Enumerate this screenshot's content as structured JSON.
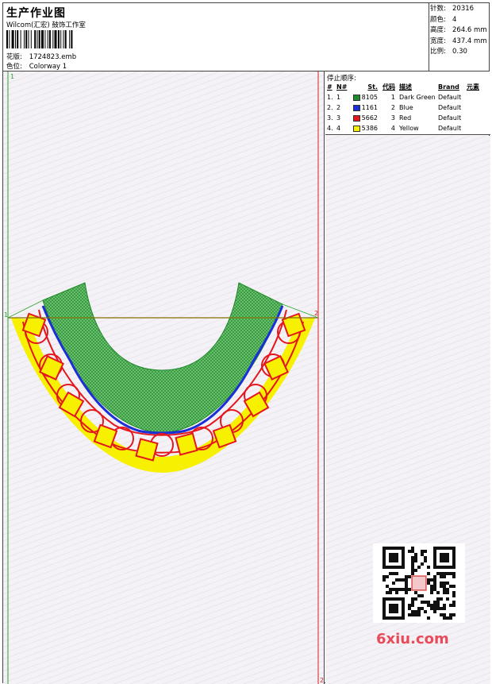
{
  "header": {
    "title": "生产作业图",
    "studio": "Wilcom(汇宏) 鼓饰工作室",
    "design_label": "花版:",
    "design_value": "1724823.emb",
    "colorway_label": "色位:",
    "colorway_value": "Colorway 1"
  },
  "stats": [
    {
      "label": "针数:",
      "value": "20316"
    },
    {
      "label": "颜色:",
      "value": "4"
    },
    {
      "label": "高度:",
      "value": "264.6 mm"
    },
    {
      "label": "宽度:",
      "value": "437.4 mm"
    },
    {
      "label": "比例:",
      "value": "0.30"
    }
  ],
  "stop_sequence": {
    "heading": "停止顺序:",
    "columns": [
      "#",
      "N#",
      "St.",
      "代码",
      "描述",
      "Brand",
      "元素"
    ],
    "rows": [
      {
        "idx": "1.",
        "n": "1",
        "color": "#1f8a2a",
        "st": "8105",
        "code": "1",
        "desc": "Dark Green",
        "brand": "Default"
      },
      {
        "idx": "2.",
        "n": "2",
        "color": "#1a2fd6",
        "st": "1161",
        "code": "2",
        "desc": "Blue",
        "brand": "Default"
      },
      {
        "idx": "3.",
        "n": "3",
        "color": "#e3171d",
        "st": "5662",
        "code": "3",
        "desc": "Red",
        "brand": "Default"
      },
      {
        "idx": "4.",
        "n": "4",
        "color": "#f7f000",
        "st": "5386",
        "code": "4",
        "desc": "Yellow",
        "brand": "Default"
      }
    ]
  },
  "canvas": {
    "marker_top_left": "1",
    "marker_left": "1",
    "marker_right": "2",
    "marker_bottom_right": "2"
  },
  "watermark": {
    "site": "6xiu.com",
    "seal": "回 宏 图 版"
  },
  "colors": {
    "dark_green": "#1f8a2a",
    "blue": "#1a2fd6",
    "red": "#e3171d",
    "yellow": "#f7f000",
    "guide_green": "#2aa52a",
    "guide_red": "#d32020",
    "baseline": "#807000"
  }
}
